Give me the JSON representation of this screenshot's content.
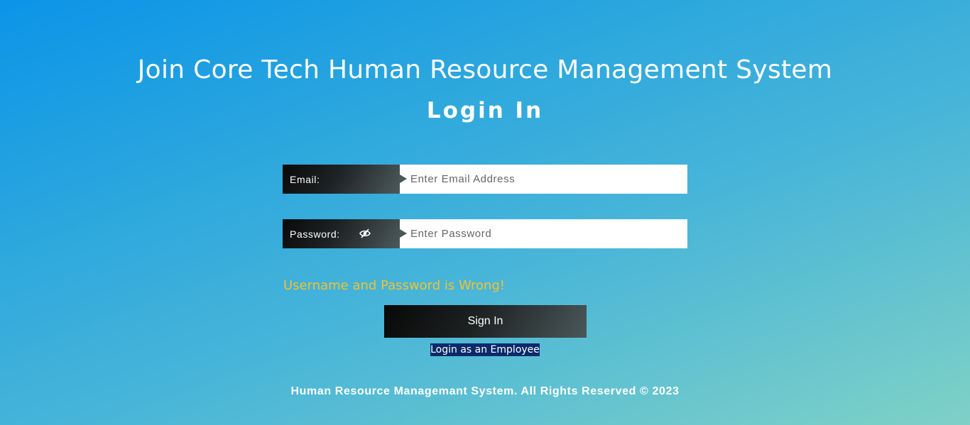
{
  "header": {
    "title": "Join Core Tech Human Resource Management System",
    "subtitle": "Login In"
  },
  "form": {
    "email": {
      "label": "Email:",
      "value": "",
      "placeholder": "Enter Email Address"
    },
    "password": {
      "label": "Password:",
      "value": "",
      "placeholder": "Enter Password",
      "toggle_icon": "eye-slash-icon"
    },
    "error_message": "Username and Password is Wrong!",
    "submit_label": "Sign In",
    "employee_link": "Login as an Employee"
  },
  "footer": {
    "text": "Human Resource Managemant System. All Rights Reserved © 2023"
  },
  "colors": {
    "gradient_start": "#0b94e8",
    "gradient_end": "#7fd1c6",
    "error": "#f2c230",
    "link_highlight": "#0a2a6a",
    "label_dark": "#0a0a0a"
  }
}
